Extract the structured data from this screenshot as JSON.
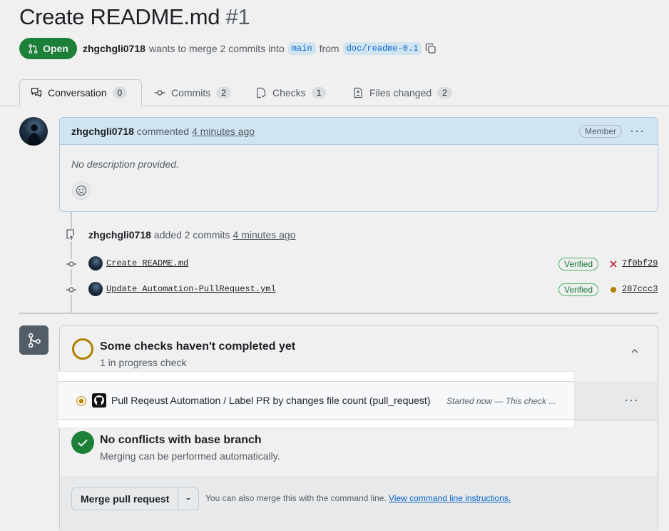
{
  "pr": {
    "title": "Create README.md",
    "number": "#1",
    "state": "Open",
    "author": "zhgchgli0718",
    "merge_text": "wants to merge 2 commits into",
    "base_branch": "main",
    "from_text": "from",
    "head_branch": "doc/readme-0.1"
  },
  "tabs": [
    {
      "label": "Conversation",
      "count": "0",
      "icon": "comment-discussion-icon"
    },
    {
      "label": "Commits",
      "count": "2",
      "icon": "git-commit-icon"
    },
    {
      "label": "Checks",
      "count": "1",
      "icon": "checklist-icon"
    },
    {
      "label": "Files changed",
      "count": "2",
      "icon": "file-diff-icon"
    }
  ],
  "comment": {
    "author": "zhgchgli0718",
    "action": "commented",
    "time": "4 minutes ago",
    "role_badge": "Member",
    "body": "No description provided."
  },
  "commits_event": {
    "author": "zhgchgli0718",
    "action": "added 2 commits",
    "time": "4 minutes ago",
    "commits": [
      {
        "message": "Create README.md",
        "badge": "Verified",
        "status": "failed",
        "sha": "7f0bf29"
      },
      {
        "message": "Update Automation-PullRequest.yml",
        "badge": "Verified",
        "status": "pending",
        "sha": "287ccc3"
      }
    ]
  },
  "merge_box": {
    "checks_title": "Some checks haven't completed yet",
    "checks_sub": "1 in progress check",
    "check_item": {
      "name": "Pull Reqeust Automation / Label PR by changes file count (pull_request)",
      "status_text": "Started now — This check ..."
    },
    "conflicts_title": "No conflicts with base branch",
    "conflicts_sub": "Merging can be performed automatically.",
    "merge_button": "Merge pull request",
    "hint_text": "You can also merge this with the command line.",
    "hint_link": "View command line instructions."
  },
  "colors": {
    "open_green": "#1f883d",
    "pending_ring": "#bf8700",
    "fail_red": "#cf222e",
    "link_blue": "#0969da"
  }
}
